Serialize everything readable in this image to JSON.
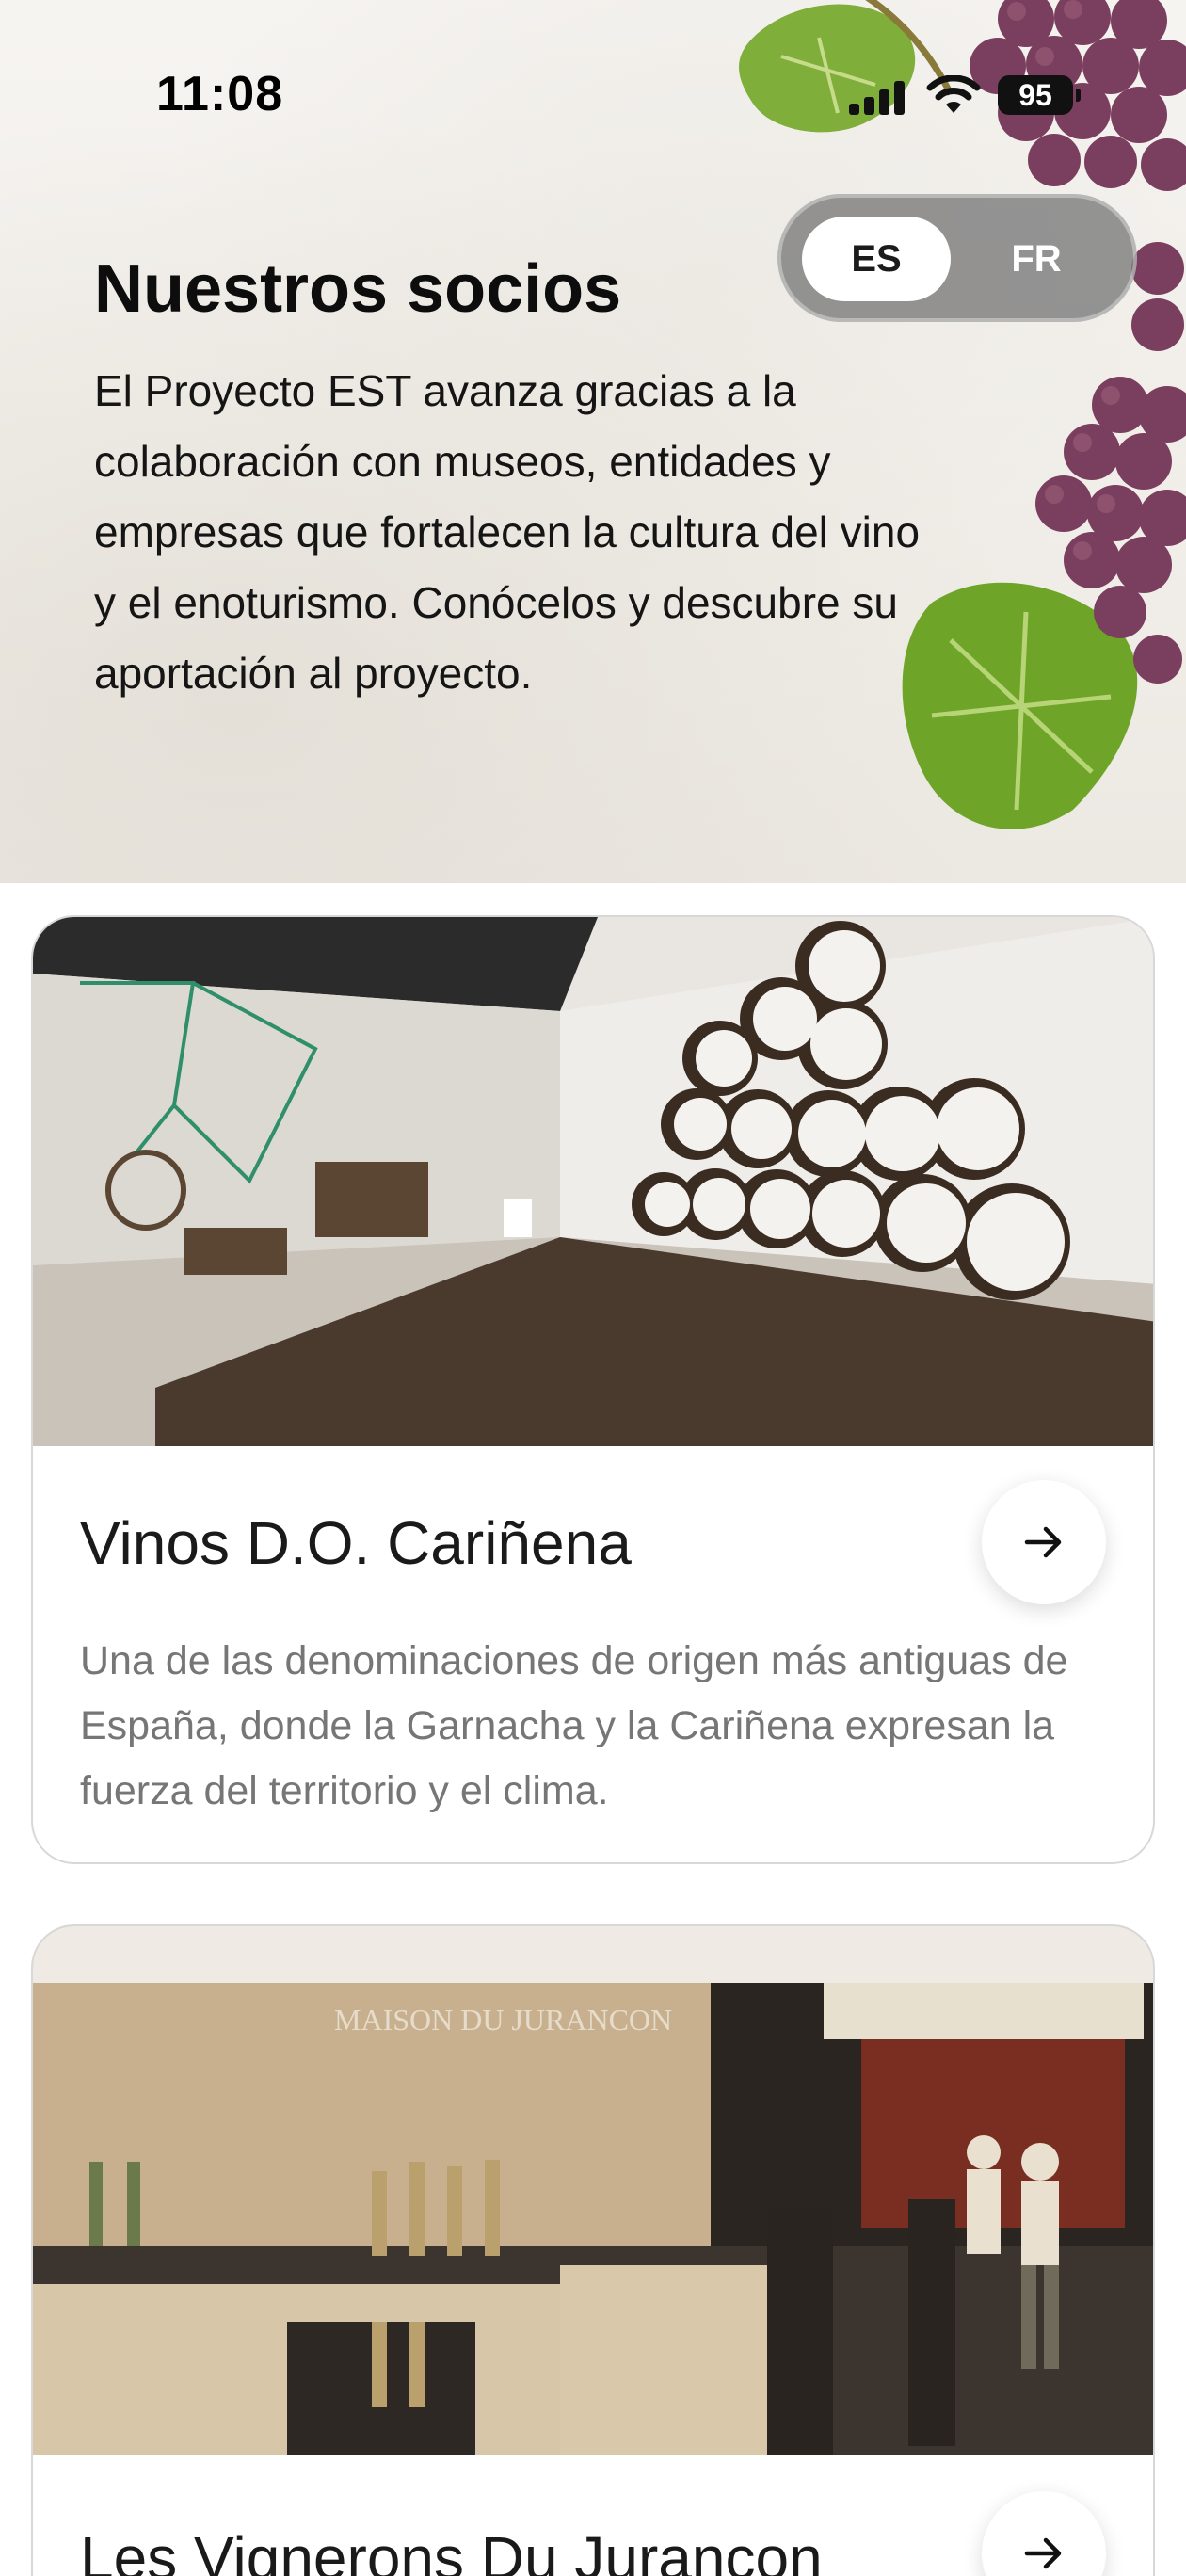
{
  "status_bar": {
    "time": "11:08",
    "battery": "95"
  },
  "language_toggle": {
    "options": [
      {
        "label": "ES",
        "selected": true
      },
      {
        "label": "FR",
        "selected": false
      }
    ]
  },
  "header": {
    "title": "Nuestros socios",
    "intro": "El Proyecto EST avanza gracias a la colaboración con museos, entidades y empresas que fortalecen la cultura del vino y el enoturismo. Conócelos y descubre su aportación al proyecto."
  },
  "partners": [
    {
      "name": "Vinos D.O. Cariñena",
      "description": "Una de las denominaciones de origen más antiguas de España, donde la Garnacha y la Cariñena expresan la fuerza del territorio y el clima."
    },
    {
      "name": "Les Vignerons Du Jurancon",
      "image_sign": "MAISON DU JURANCON"
    }
  ],
  "colors": {
    "toggle_bg": "#787878",
    "card_border": "#d8d8d8",
    "desc_text": "#767676"
  },
  "icons": [
    "signal-icon",
    "wifi-icon",
    "battery-icon",
    "arrow-right-icon",
    "grapes-illustration"
  ]
}
